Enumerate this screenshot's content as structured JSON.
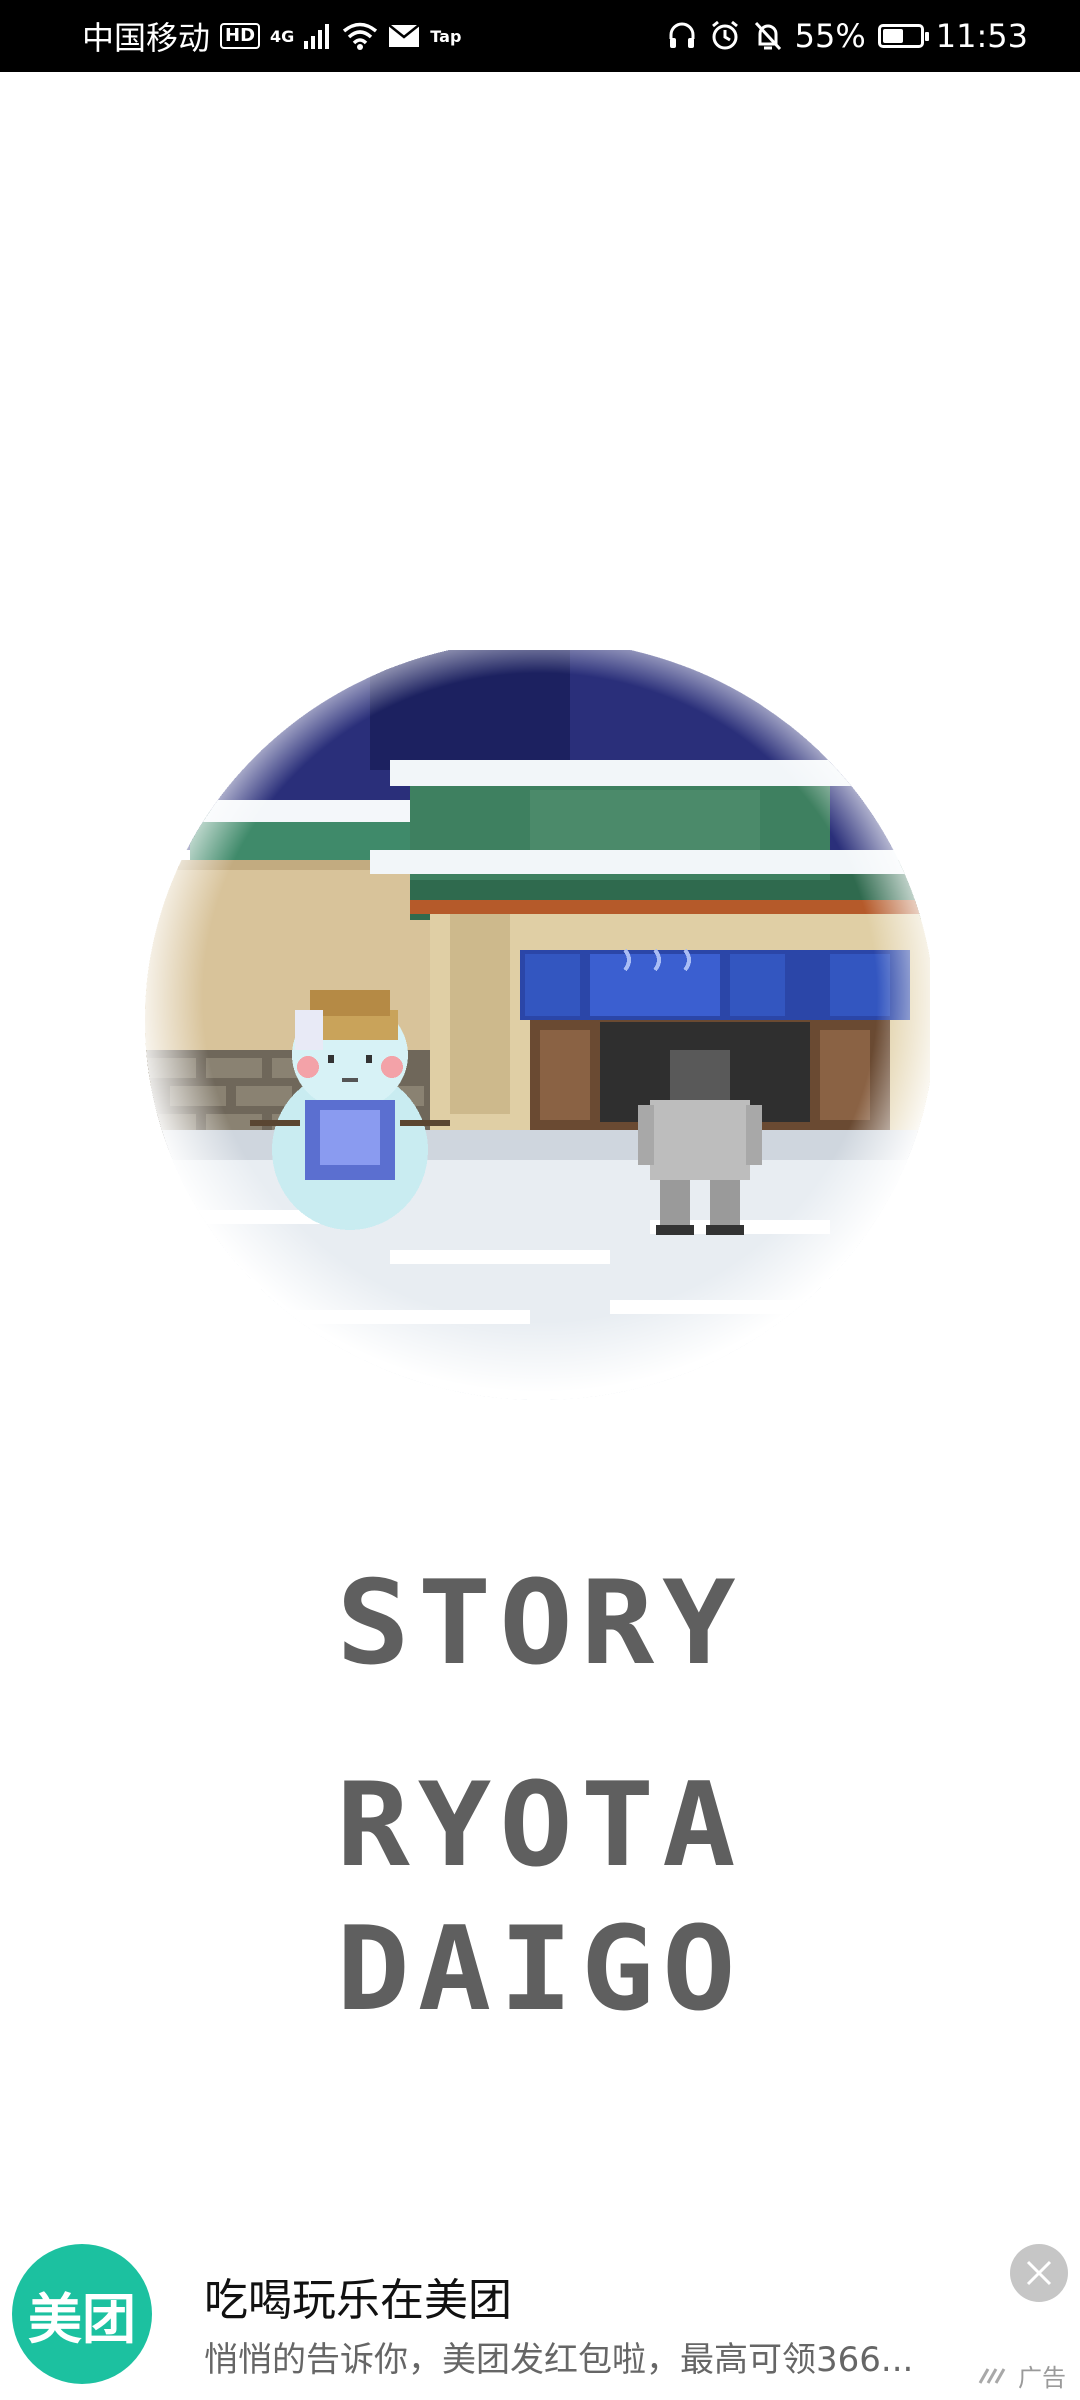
{
  "status_bar": {
    "carrier": "中国移动",
    "hd_badge": "HD",
    "network": "4G",
    "tap_label": "Tap",
    "battery_percent": "55%",
    "battery_level": 0.55,
    "time": "11:53",
    "icons": [
      "signal-icon",
      "wifi-icon",
      "mail-icon",
      "headphones-icon",
      "alarm-icon",
      "mute-bell-icon",
      "battery-icon"
    ]
  },
  "story": {
    "line1": "STORY",
    "line2": "RYOTA",
    "line3": "DAIGO"
  },
  "ad": {
    "logo_text": "美团",
    "title": "吃喝玩乐在美团",
    "subtitle": "悄悄的告诉你，美团发红包啦，最高可领366...",
    "tag": "广告",
    "colors": {
      "brand": "#1cc1a0"
    }
  }
}
